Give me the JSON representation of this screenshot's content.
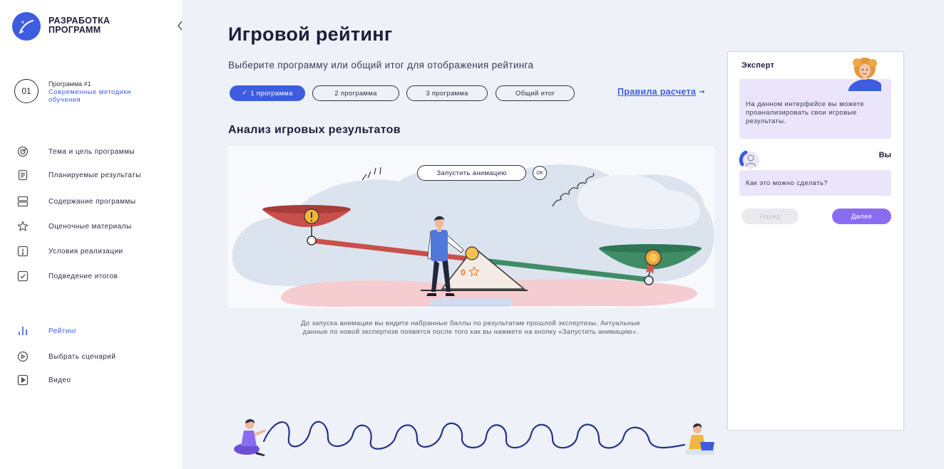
{
  "sidebar": {
    "brand_line1": "РАЗРАБОТКА",
    "brand_line2": "ПРОГРАММ",
    "program": {
      "number": "01",
      "title": "Программа #1",
      "subtitle": "Современные методики обучения"
    },
    "nav": [
      {
        "label": "Тема и цель программы",
        "icon": "target-icon"
      },
      {
        "label": "Планируемые результаты",
        "icon": "list-icon"
      },
      {
        "label": "Содержание программы",
        "icon": "layout-icon"
      },
      {
        "label": "Оценочные материалы",
        "icon": "star-icon"
      },
      {
        "label": "Условия реализации",
        "icon": "info-square-icon"
      },
      {
        "label": "Подведение итогов",
        "icon": "check-square-icon"
      }
    ],
    "tools": [
      {
        "label": "Рейтинг",
        "icon": "bar-chart-icon",
        "active": true
      },
      {
        "label": "Выбрать сценарий",
        "icon": "play-circle-icon",
        "active": false
      },
      {
        "label": "Видео",
        "icon": "video-icon",
        "active": false
      }
    ]
  },
  "header": {
    "title": "Игровой рейтинг",
    "subtitle": "Выберите программу или общий итог для отображения рейтинга"
  },
  "tabs": [
    {
      "label": "1 программа",
      "selected": true
    },
    {
      "label": "2 программа",
      "selected": false
    },
    {
      "label": "3 программа",
      "selected": false
    },
    {
      "label": "Общий итог",
      "selected": false
    }
  ],
  "rules_link": {
    "label": "Правила расчета",
    "icon": "arrow-right-icon"
  },
  "analysis": {
    "title": "Анализ игровых результатов",
    "launch_button": "Запустить анимацию",
    "ok_label": "ОК",
    "score": "0",
    "caption_lines": [
      "До запуска анимации вы видите набранные баллы по результатам прошлой экспертизы. Актуальные",
      "данные по новой экспертизе появятся после того как вы нажмете на кнопку «Запустить анимацию»."
    ]
  },
  "assistant": {
    "expert_name": "Эксперт",
    "expert_message": "На данном интерфейсе вы можете проанализировать свои игровые результаты.",
    "user_name": "Вы",
    "user_message": "Как это можно сделать?",
    "back_button": "Назад",
    "next_button": "Далее"
  },
  "colors": {
    "accent": "#3d5ce0",
    "purple": "#8a6cf0",
    "bubble": "#ebe5fb",
    "background": "#eef2f8",
    "red_pan": "#c9504a",
    "green_pan": "#3f8c66"
  }
}
